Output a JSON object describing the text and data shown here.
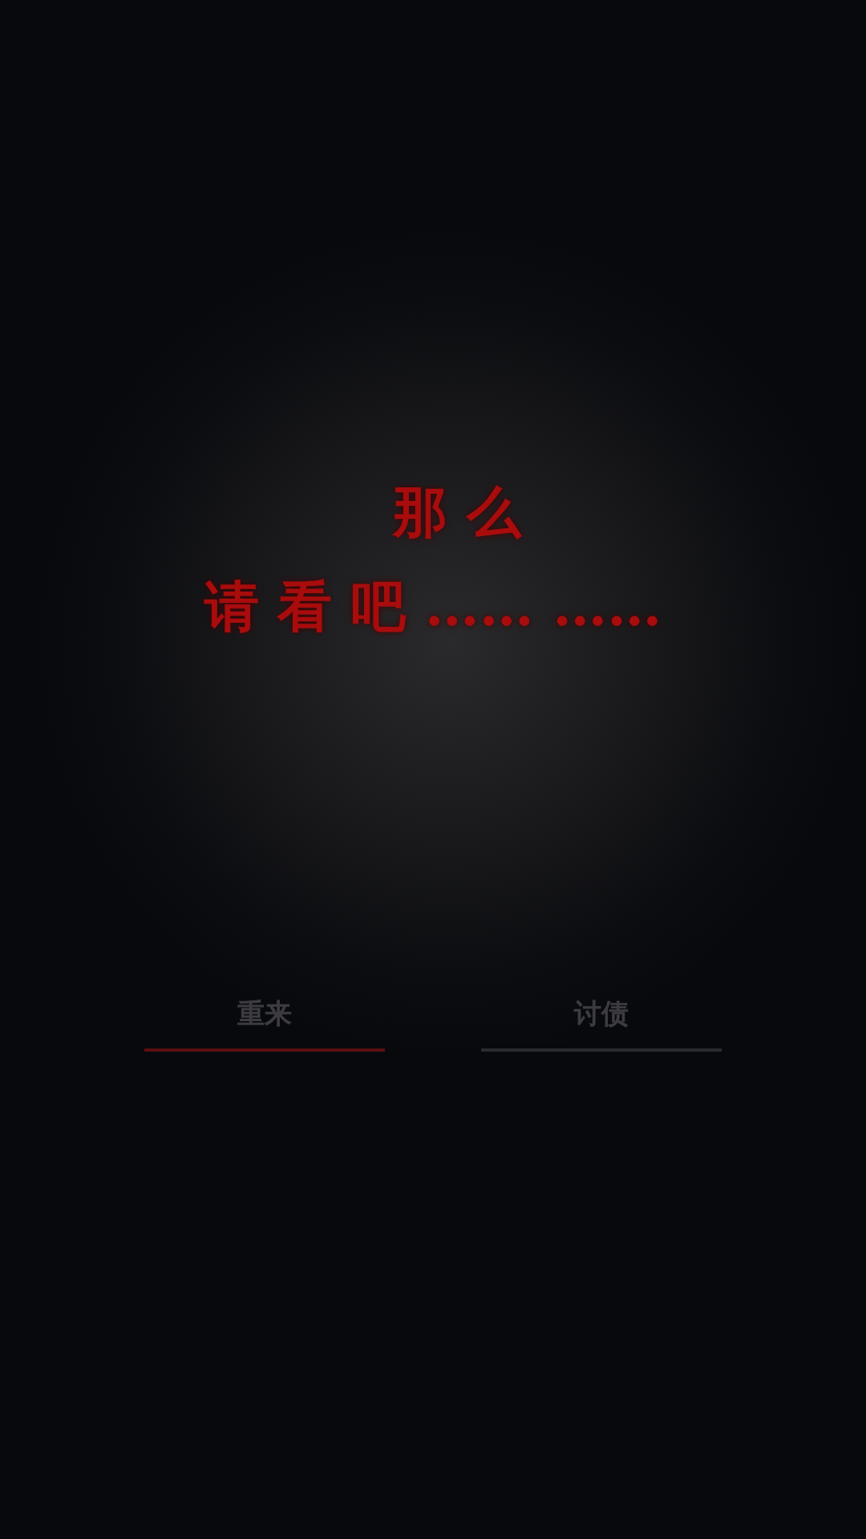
{
  "message": {
    "lines": [
      "那 么",
      "请 看 吧 …… ……"
    ]
  },
  "buttons": [
    {
      "label": "重来",
      "color": "#5a1010"
    },
    {
      "label": "讨债",
      "color": "#2a2a30"
    }
  ]
}
